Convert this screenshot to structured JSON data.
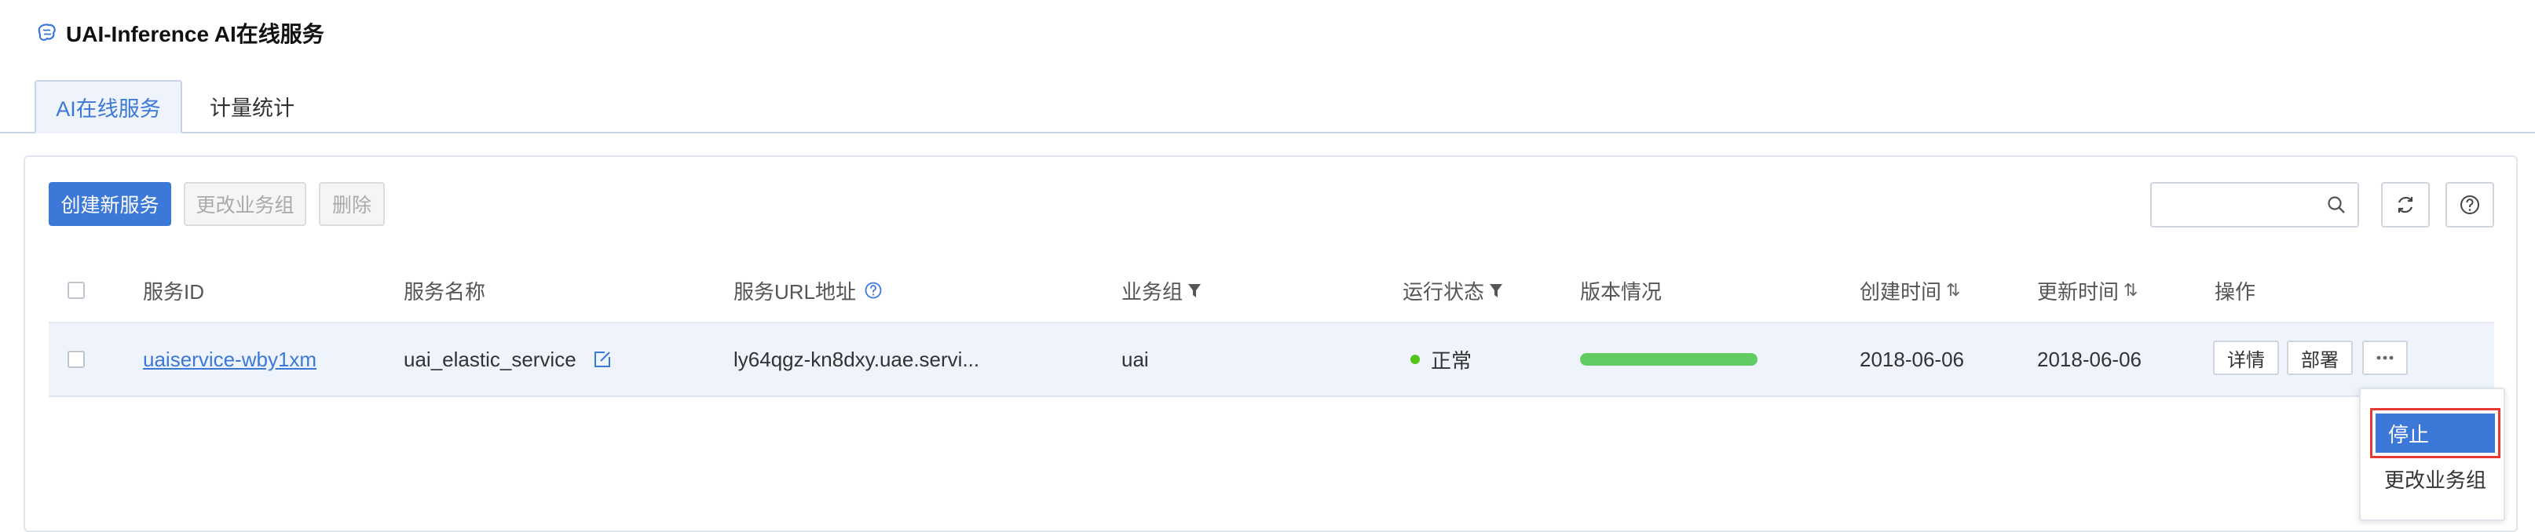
{
  "header": {
    "title": "UAI-Inference AI在线服务",
    "icon": "brain-icon"
  },
  "tabs": [
    {
      "label": "AI在线服务",
      "active": true
    },
    {
      "label": "计量统计",
      "active": false
    }
  ],
  "toolbar": {
    "create_label": "创建新服务",
    "regroup_label": "更改业务组",
    "delete_label": "删除",
    "search_value": "",
    "search_placeholder": ""
  },
  "table": {
    "headers": {
      "id": "服务ID",
      "name": "服务名称",
      "url": "服务URL地址",
      "group": "业务组",
      "status": "运行状态",
      "version": "版本情况",
      "created": "创建时间",
      "updated": "更新时间",
      "actions": "操作"
    },
    "rows": [
      {
        "id": "uaiservice-wby1xm",
        "name": "uai_elastic_service",
        "url": "ly64qgz-kn8dxy.uae.servi...",
        "group": "uai",
        "status": "正常",
        "version_progress": 1.0,
        "created": "2018-06-06",
        "updated": "2018-06-06",
        "detail_label": "详情",
        "deploy_label": "部署"
      }
    ]
  },
  "dropdown": {
    "stop_label": "停止",
    "regroup_label": "更改业务组"
  },
  "colors": {
    "accent": "#3c78d8",
    "status_ok": "#52c41a",
    "progress": "#62cc63",
    "highlight_border": "#e53935"
  }
}
